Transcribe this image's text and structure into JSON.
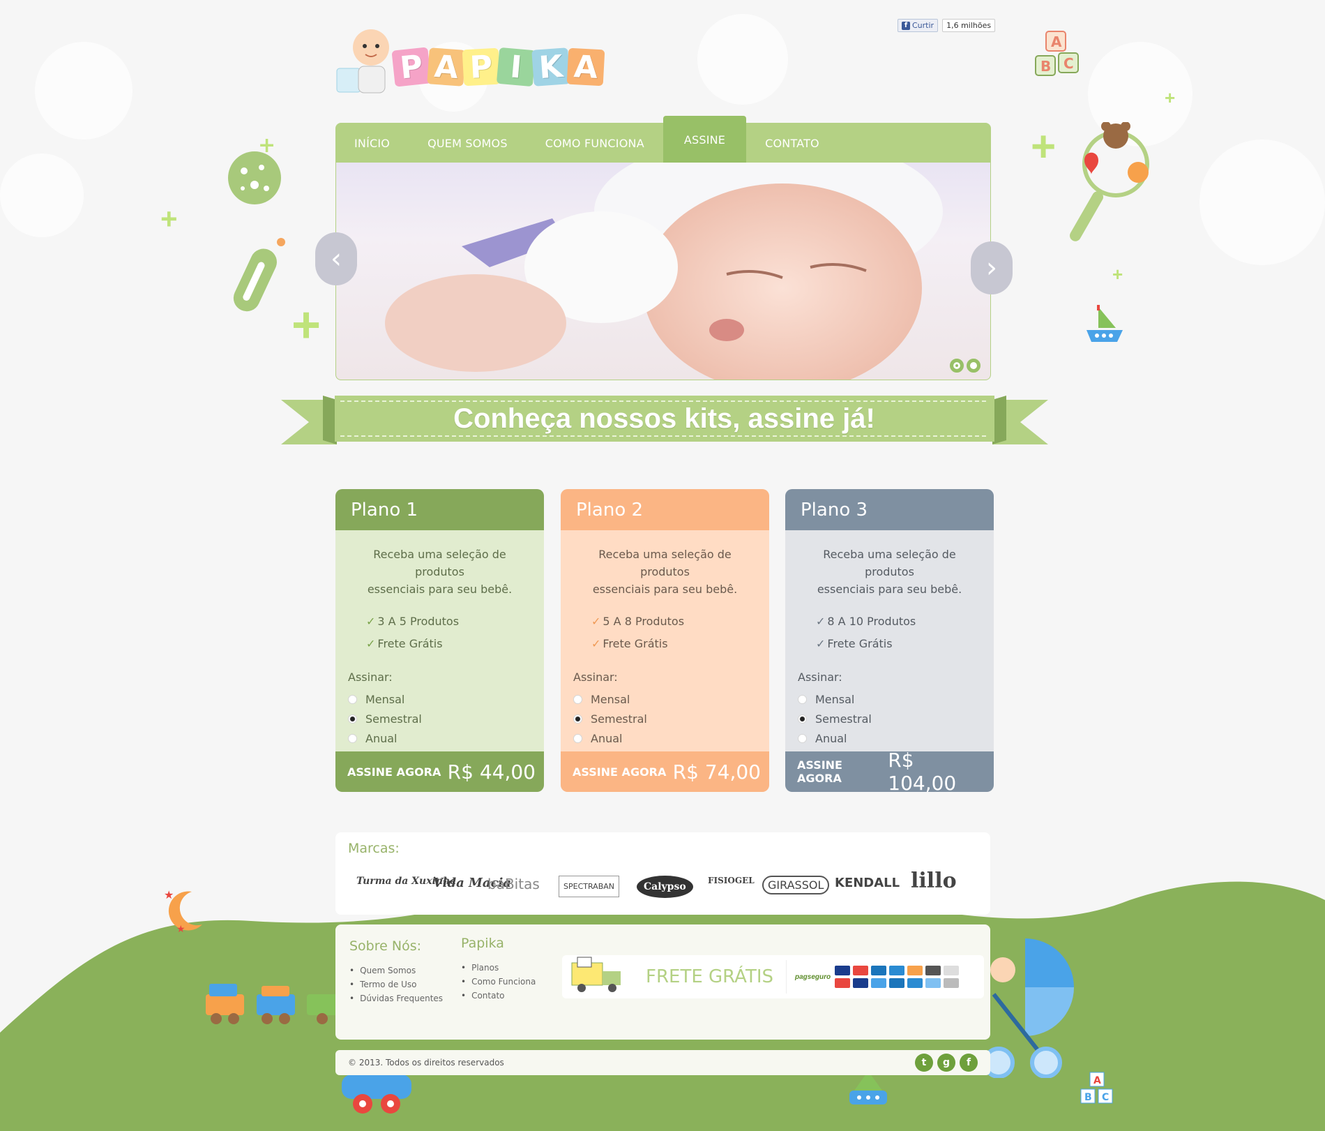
{
  "social_like": {
    "label": "Curtir",
    "count": "1,6 milhões"
  },
  "brand": {
    "logo_letters": [
      "P",
      "A",
      "P",
      "I",
      "K",
      "A"
    ],
    "logo_colors": [
      "#f5a3c7",
      "#f8c27a",
      "#fff08a",
      "#9ad59c",
      "#9fd3e5",
      "#f9b06e"
    ]
  },
  "nav": {
    "items": [
      "INÍCIO",
      "QUEM SOMOS",
      "COMO FUNCIONA",
      "ASSINE",
      "CONTATO"
    ],
    "active": "ASSINE"
  },
  "slider": {
    "prev_icon": "chevron-left-icon",
    "next_icon": "chevron-right-icon",
    "current_slide": 1,
    "slide_count": 2
  },
  "banner": {
    "title": "Conheça nossos kits, assine já!"
  },
  "plans": [
    {
      "name": "Plano 1",
      "desc_line1": "Receba uma seleção de produtos",
      "desc_line2": "essenciais para seu bebê.",
      "feature1": "3 A 5 Produtos",
      "feature2": "Frete Grátis",
      "subscribe_label": "Assinar:",
      "options": [
        "Mensal",
        "Semestral",
        "Anual"
      ],
      "selected": "Semestral",
      "cta": "ASSINE AGORA",
      "price": "R$ 44,00",
      "head_color": "#86a85a",
      "body_color": "#e1eccf",
      "foot_color": "#86a85a",
      "text_color": "#5e6e4a",
      "check_color": "#7aa34a"
    },
    {
      "name": "Plano 2",
      "desc_line1": "Receba uma seleção de produtos",
      "desc_line2": "essenciais para seu bebê.",
      "feature1": "5 A 8 Produtos",
      "feature2": "Frete Grátis",
      "subscribe_label": "Assinar:",
      "options": [
        "Mensal",
        "Semestral",
        "Anual"
      ],
      "selected": "Semestral",
      "cta": "ASSINE AGORA",
      "price": "R$ 74,00",
      "head_color": "#fbb584",
      "body_color": "#ffdcc4",
      "foot_color": "#fbb584",
      "text_color": "#6a5a4d",
      "check_color": "#f09a55"
    },
    {
      "name": "Plano 3",
      "desc_line1": "Receba uma seleção de produtos",
      "desc_line2": "essenciais para seu bebê.",
      "feature1": "8 A 10 Produtos",
      "feature2": "Frete Grátis",
      "subscribe_label": "Assinar:",
      "options": [
        "Mensal",
        "Semestral",
        "Anual"
      ],
      "selected": "Semestral",
      "cta": "ASSINE AGORA",
      "price": "R$ 104,00",
      "head_color": "#7f90a1",
      "body_color": "#e2e4e8",
      "foot_color": "#7f90a1",
      "text_color": "#555b62",
      "check_color": "#6b7682"
    }
  ],
  "brands": {
    "title": "Marcas:",
    "logos": [
      "Turma da Xuxinha",
      "Vida Macia",
      "baBitas",
      "SPECTRABAN",
      "Calypso",
      "FISIOGEL",
      "GIRASSOL",
      "KENDALL",
      "lillo"
    ]
  },
  "footer": {
    "about": {
      "title": "Sobre Nós:",
      "links": [
        "Quem Somos",
        "Termo de Uso",
        "Dúvidas Frequentes"
      ]
    },
    "papika": {
      "title": "Papika",
      "links": [
        "Planos",
        "Como Funciona",
        "Contato"
      ]
    },
    "shipping": {
      "label": "FRETE GRÁTIS"
    },
    "payment": {
      "label": "pagseguro"
    }
  },
  "copyright": "© 2013. Todos os direitos reservados",
  "social": [
    {
      "name": "twitter",
      "glyph": "t"
    },
    {
      "name": "google",
      "glyph": "g"
    },
    {
      "name": "facebook",
      "glyph": "f"
    }
  ],
  "colors": {
    "primary_green": "#b4d184",
    "active_green": "#98c067",
    "ground_green": "#8ab15a"
  }
}
